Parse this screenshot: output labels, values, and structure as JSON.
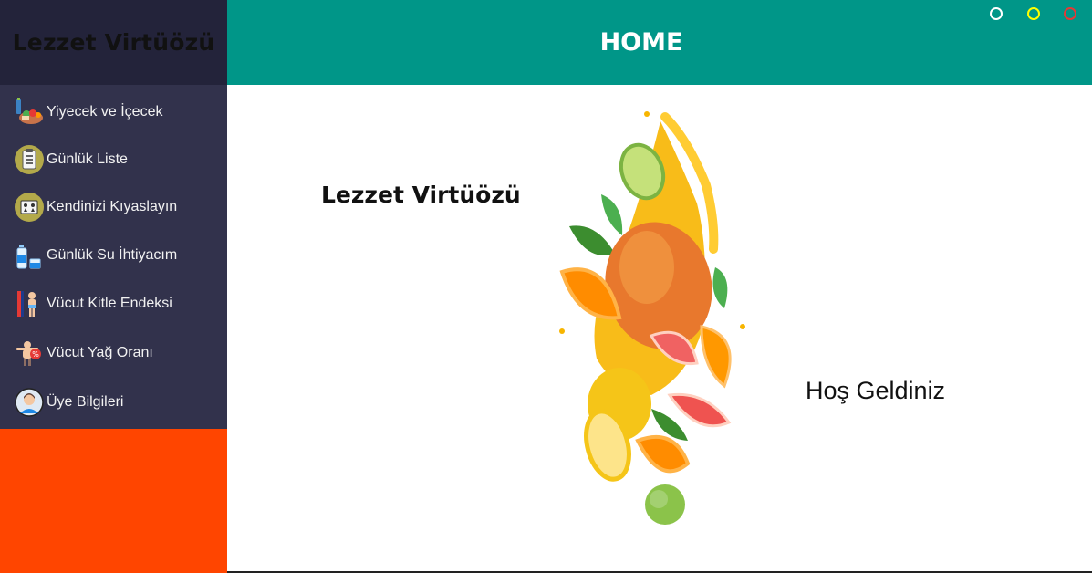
{
  "app": {
    "brand": "Lezzet Virtüözü",
    "header_title": "HOME"
  },
  "window_controls": [
    {
      "name": "minimize",
      "color": "#FFFFFF"
    },
    {
      "name": "maximize",
      "color": "#FFFF00"
    },
    {
      "name": "close",
      "color": "#E53935"
    }
  ],
  "sidebar": {
    "items": [
      {
        "label": "Yiyecek ve İçecek",
        "icon": "food-drink-icon"
      },
      {
        "label": "Günlük Liste",
        "icon": "checklist-icon"
      },
      {
        "label": "Kendinizi Kıyaslayın",
        "icon": "compare-icon"
      },
      {
        "label": "Günlük Su İhtiyacım",
        "icon": "water-bottle-icon"
      },
      {
        "label": "Vücut Kitle Endeksi",
        "icon": "bmi-icon"
      },
      {
        "label": "Vücut Yağ Oranı",
        "icon": "body-fat-icon"
      },
      {
        "label": "Üye Bilgileri",
        "icon": "user-avatar-icon"
      }
    ]
  },
  "main": {
    "title": "Lezzet Virtüözü",
    "welcome": "Hoş Geldiniz",
    "image": "fruit-splash-image"
  },
  "colors": {
    "sidebar_top": "#23233A",
    "sidebar_menu": "#32324C",
    "sidebar_bottom": "#FF4500",
    "header": "#009688"
  }
}
